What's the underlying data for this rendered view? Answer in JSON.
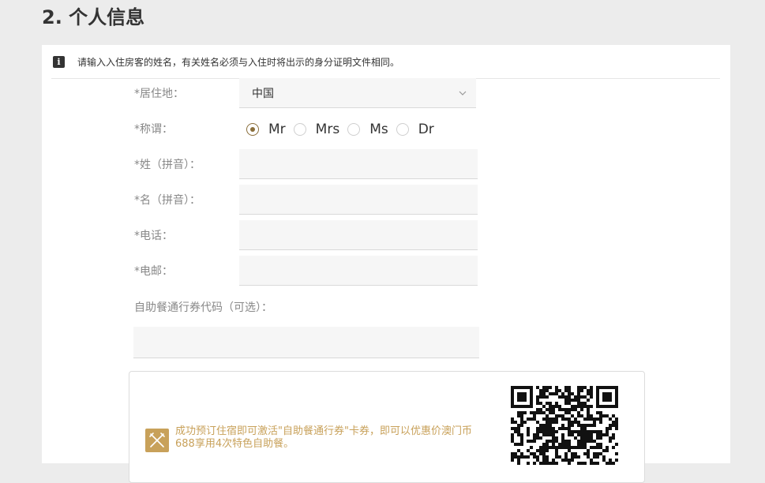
{
  "section": {
    "title": "2. 个人信息"
  },
  "notice": {
    "icon": "info-icon",
    "text": "请输入入住房客的姓名，有关姓名必须与入住时将出示的身分证明文件相同。"
  },
  "form": {
    "residence": {
      "label": "*居住地：",
      "value": "中国"
    },
    "salutation": {
      "label": "*称谓：",
      "options": [
        "Mr",
        "Mrs",
        "Ms",
        "Dr"
      ],
      "selected": "Mr"
    },
    "surname": {
      "label": "*姓（拼音）：",
      "value": ""
    },
    "given_name": {
      "label": "*名（拼音）：",
      "value": ""
    },
    "phone": {
      "label": "*电话：",
      "value": ""
    },
    "email": {
      "label": "*电邮：",
      "value": ""
    },
    "voucher_code": {
      "label": "自助餐通行券代码（可选）：",
      "value": ""
    }
  },
  "promo": {
    "icon": "utensils-icon",
    "text": "成功预订住宿即可激活\"自助餐通行券\"卡券，即可以优惠价澳门币688享用4次特色自助餐。",
    "qr": "qr-code"
  },
  "colors": {
    "accent": "#8a6e3b",
    "promo": "#c8a15a",
    "background": "#ececec"
  }
}
